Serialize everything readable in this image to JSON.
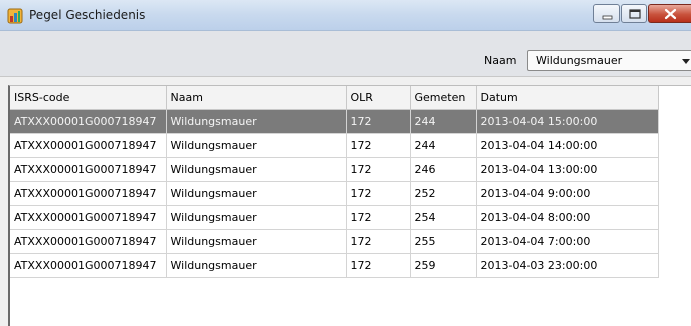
{
  "window": {
    "title": "Pegel Geschiedenis"
  },
  "filter": {
    "label": "Naam",
    "selected": "Wildungsmauer"
  },
  "table": {
    "columns": [
      "ISRS-code",
      "Naam",
      "OLR",
      "Gemeten",
      "Datum"
    ],
    "rows": [
      {
        "isrs": "ATXXX00001G000718947",
        "naam": "Wildungsmauer",
        "olr": "172",
        "gemeten": "244",
        "datum": "2013-04-04 15:00:00",
        "selected": true
      },
      {
        "isrs": "ATXXX00001G000718947",
        "naam": "Wildungsmauer",
        "olr": "172",
        "gemeten": "244",
        "datum": "2013-04-04 14:00:00"
      },
      {
        "isrs": "ATXXX00001G000718947",
        "naam": "Wildungsmauer",
        "olr": "172",
        "gemeten": "246",
        "datum": "2013-04-04 13:00:00"
      },
      {
        "isrs": "ATXXX00001G000718947",
        "naam": "Wildungsmauer",
        "olr": "172",
        "gemeten": "252",
        "datum": "2013-04-04 9:00:00"
      },
      {
        "isrs": "ATXXX00001G000718947",
        "naam": "Wildungsmauer",
        "olr": "172",
        "gemeten": "254",
        "datum": "2013-04-04 8:00:00"
      },
      {
        "isrs": "ATXXX00001G000718947",
        "naam": "Wildungsmauer",
        "olr": "172",
        "gemeten": "255",
        "datum": "2013-04-04 7:00:00"
      },
      {
        "isrs": "ATXXX00001G000718947",
        "naam": "Wildungsmauer",
        "olr": "172",
        "gemeten": "259",
        "datum": "2013-04-03 23:00:00"
      }
    ]
  },
  "icons": {
    "app": "gauge-app-icon",
    "minimize": "minimize-icon",
    "maximize": "maximize-icon",
    "close": "close-icon",
    "dropdown": "chevron-down-icon"
  },
  "colors": {
    "selected_row": "#7b7b7b",
    "close_button": "#c9533d",
    "titlebar": "#c8d9ee"
  }
}
